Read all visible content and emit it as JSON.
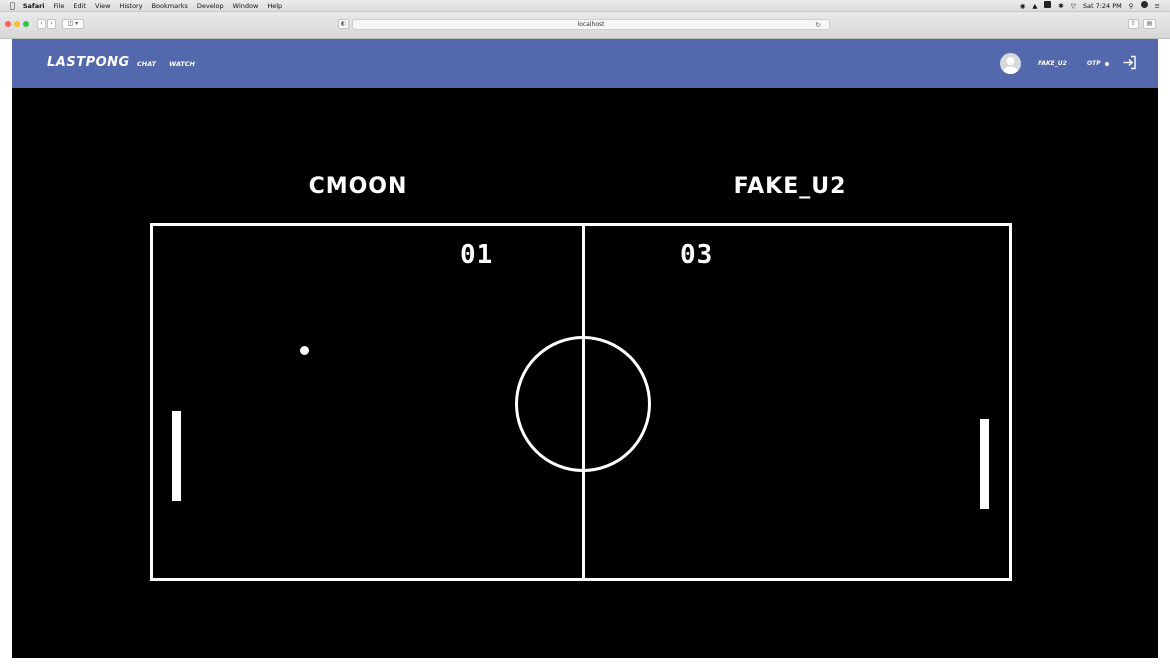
{
  "menubar": {
    "app_name": "Safari",
    "items": [
      "File",
      "Edit",
      "View",
      "History",
      "Bookmarks",
      "Develop",
      "Window",
      "Help"
    ],
    "clock": "Sat 7:24 PM"
  },
  "browser": {
    "url": "localhost"
  },
  "header": {
    "logo": "LASTPONG",
    "nav": {
      "chat": "CHAT",
      "watch": "WATCH"
    },
    "user_name": "FAKE_U2",
    "otp_label": "OTP",
    "accent_color": "#5468ae"
  },
  "game": {
    "left_player": "CMOON",
    "right_player": "FAKE_U2",
    "left_score": "01",
    "right_score": "03",
    "background_color": "#000000",
    "line_color": "#ffffff"
  }
}
